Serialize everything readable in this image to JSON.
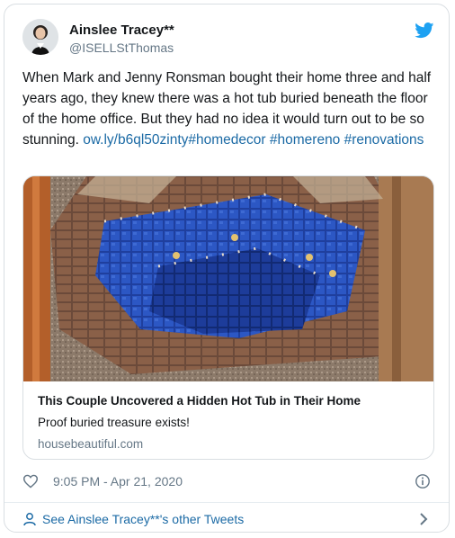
{
  "tweet": {
    "author_name": "Ainslee Tracey**",
    "author_handle": "@ISELLStThomas",
    "text_main": "When Mark and Jenny Ronsman bought their home three and half years ago, they knew there was a hot tub buried beneath the floor of the home office. But they had no idea it would turn out to be so stunning. ",
    "link_url": "ow.ly/b6ql50zinty",
    "hashtags": [
      "#homedecor",
      "#homereno",
      "#renovations"
    ],
    "timestamp": "9:05 PM - Apr 21, 2020"
  },
  "card": {
    "title": "This Couple Uncovered a Hidden Hot Tub in Their Home",
    "description": "Proof buried treasure exists!",
    "domain": "housebeautiful.com"
  },
  "footer": {
    "label": "See Ainslee Tracey**'s other Tweets"
  },
  "icons": {
    "brand": "twitter-bird-icon",
    "like": "heart-icon",
    "info": "info-icon",
    "person": "person-icon",
    "chevron": "chevron-right-icon"
  },
  "colors": {
    "link": "#1b6aa5",
    "twitter_blue": "#1da1f2",
    "muted": "#657786",
    "text": "#14171a"
  }
}
